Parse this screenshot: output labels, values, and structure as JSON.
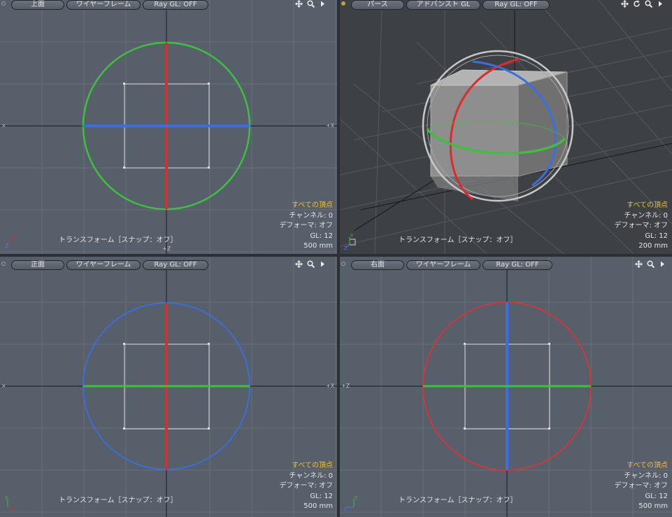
{
  "viewports": {
    "top": {
      "view_label": "上面",
      "shading_label": "ワイヤーフレーム",
      "raygl_label": "Ray GL: OFF",
      "info": {
        "selection": "すべての頂点",
        "channel": "チャンネル: 0",
        "deformer": "デフォーマ: オフ",
        "gl": "GL: 12",
        "scale": "500 mm"
      },
      "status": "トランスフォーム［スナップ：オフ］",
      "colors": {
        "circle": "#3fbf3f",
        "vertical_axis": "#cc3333",
        "horizontal_axis": "#3a6fe0"
      }
    },
    "perspective": {
      "view_label": "パース",
      "shading_label": "アドバンスト GL",
      "raygl_label": "Ray GL: OFF",
      "info": {
        "selection": "すべての頂点",
        "channel": "チャンネル: 0",
        "deformer": "デフォーマ: オフ",
        "gl": "GL: 12",
        "scale": "200 mm"
      },
      "status": "トランスフォーム［スナップ：オフ］"
    },
    "front": {
      "view_label": "正面",
      "shading_label": "ワイヤーフレーム",
      "raygl_label": "Ray GL: OFF",
      "info": {
        "selection": "すべての頂点",
        "channel": "チャンネル: 0",
        "deformer": "デフォーマ: オフ",
        "gl": "GL: 12",
        "scale": "500 mm"
      },
      "status": "トランスフォーム［スナップ：オフ］",
      "colors": {
        "circle": "#3a6fe0",
        "vertical_axis": "#cc3333",
        "horizontal_axis": "#3fbf3f"
      }
    },
    "right": {
      "view_label": "右面",
      "shading_label": "ワイヤーフレーム",
      "raygl_label": "Ray GL: OFF",
      "info": {
        "selection": "すべての頂点",
        "channel": "チャンネル: 0",
        "deformer": "デフォーマ: オフ",
        "gl": "GL: 12",
        "scale": "500 mm"
      },
      "status": "トランスフォーム［スナップ：オフ］",
      "colors": {
        "circle": "#dd3333",
        "vertical_axis": "#3a6fe0",
        "horizontal_axis": "#3fbf3f"
      }
    }
  },
  "icons": {
    "pan": "move-arrows-icon",
    "zoom": "magnifier-icon",
    "rotate": "rotate-icon",
    "menu": "triangle-menu-icon"
  }
}
